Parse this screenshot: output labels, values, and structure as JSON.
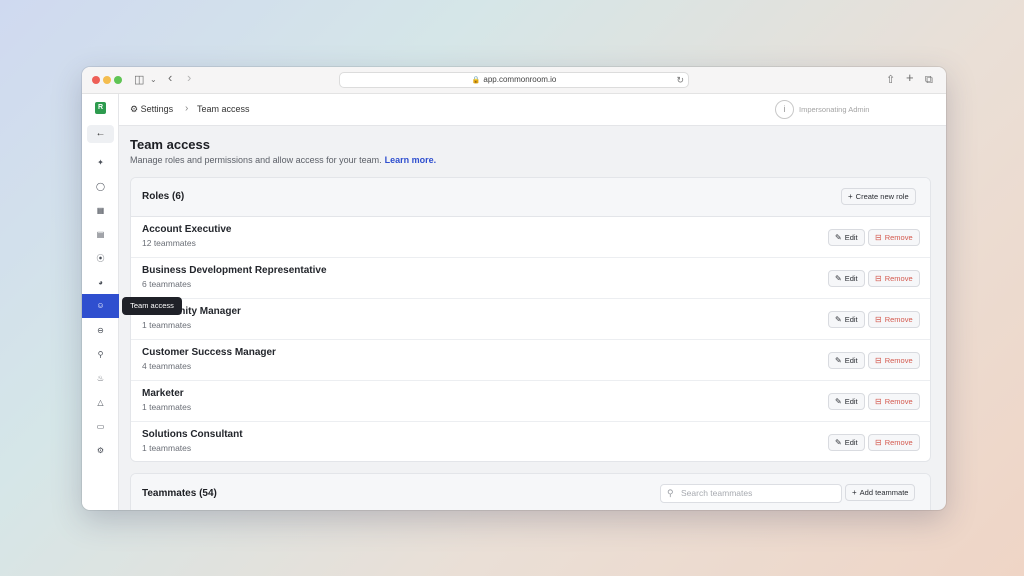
{
  "browser": {
    "url": "app.commonroom.io"
  },
  "sidebar": {
    "logo": "R",
    "active_tooltip": "Team access",
    "icons": [
      "back-arrow-icon",
      "activity-icon",
      "tag-icon",
      "apps-icon",
      "table-icon",
      "share-icon",
      "globe-icon",
      "user-icon",
      "minus-circle-icon",
      "key-icon",
      "org-icon",
      "bell-icon",
      "monitor-icon",
      "gear-icon"
    ]
  },
  "topbar": {
    "breadcrumb_settings": "Settings",
    "breadcrumb_current": "Team access",
    "impersonating": "Impersonating Admin"
  },
  "page": {
    "title": "Team access",
    "subtitle": "Manage roles and permissions and allow access for your team.",
    "learn_more": "Learn more."
  },
  "roles": {
    "header": "Roles (6)",
    "create_label": "Create new role",
    "edit_label": "Edit",
    "remove_label": "Remove",
    "items": [
      {
        "name": "Account Executive",
        "count": "12 teammates"
      },
      {
        "name": "Business Development Representative",
        "count": "6 teammates"
      },
      {
        "name": "Community Manager",
        "count": "1 teammates"
      },
      {
        "name": "Customer Success Manager",
        "count": "4 teammates"
      },
      {
        "name": "Marketer",
        "count": "1 teammates"
      },
      {
        "name": "Solutions Consultant",
        "count": "1 teammates"
      }
    ]
  },
  "teammates": {
    "header": "Teammates (54)",
    "search_placeholder": "Search teammates",
    "add_label": "Add teammate"
  }
}
